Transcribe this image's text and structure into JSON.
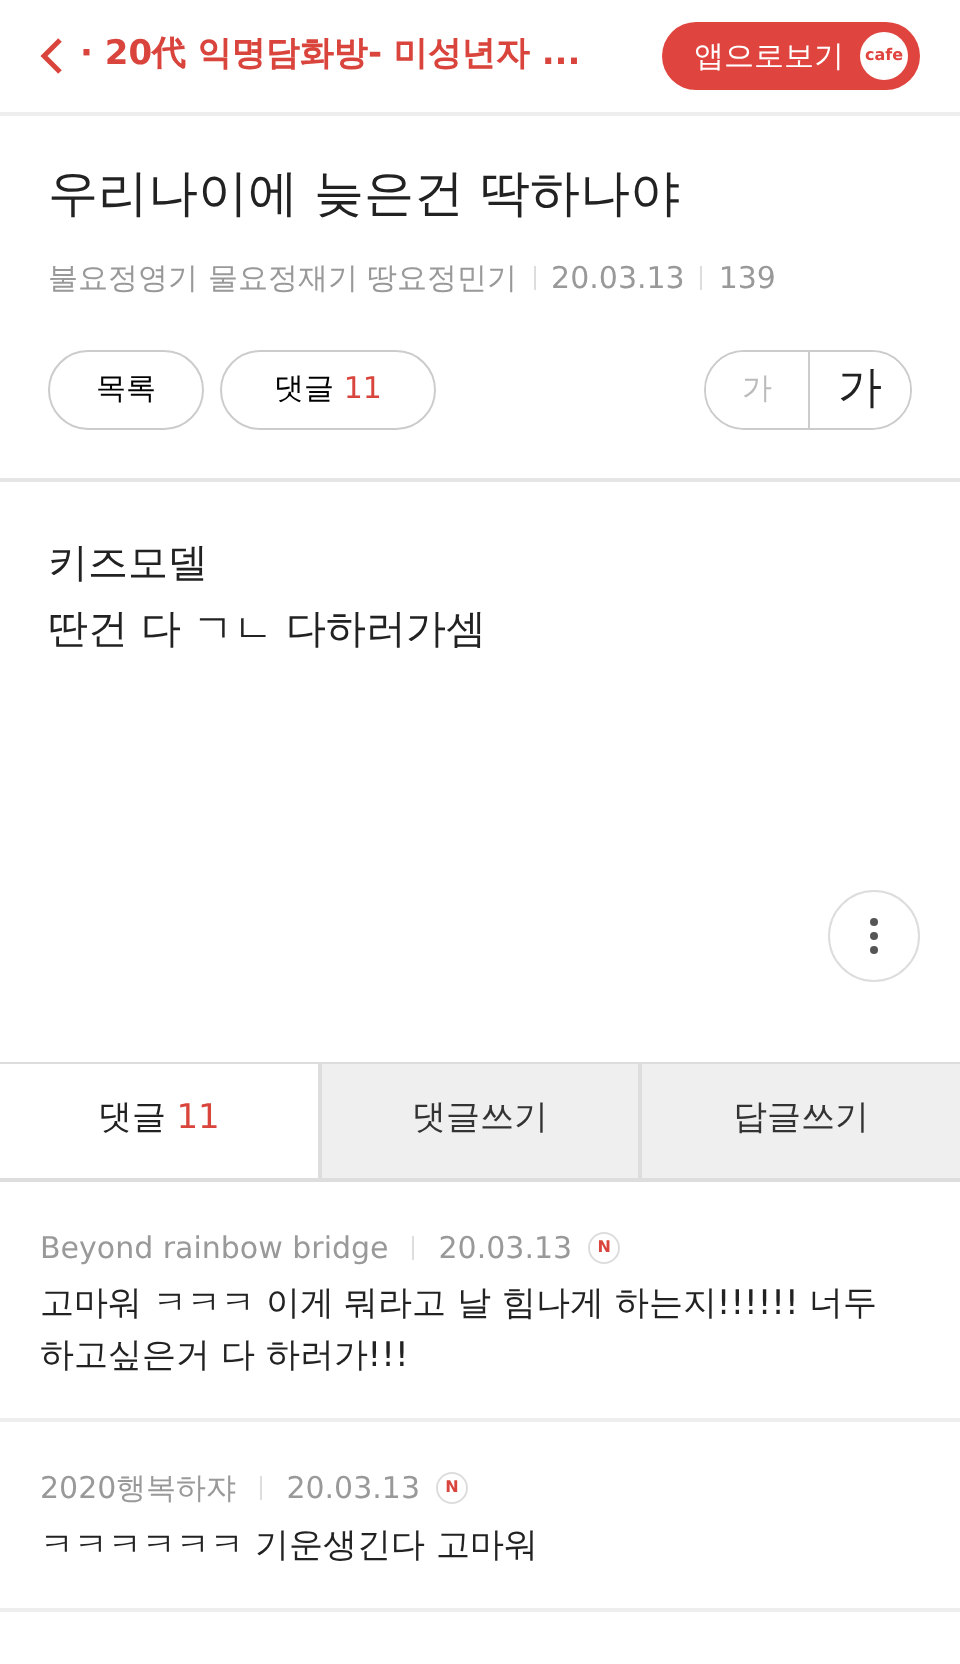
{
  "header": {
    "cafe_title": "· 20代 익명담화방- 미성년자 ...",
    "app_button": "앱으로보기",
    "app_logo": "cafe"
  },
  "post": {
    "title": "우리나이에 늦은건 딱하나야",
    "author": "불요정영기 물요정재기 땅요정민기",
    "date": "20.03.13",
    "views": "139"
  },
  "actions": [
    {
      "label": "목록"
    },
    {
      "label": "댓글",
      "count": "11"
    }
  ],
  "font_sizes": [
    {
      "label": "가",
      "selected": false
    },
    {
      "label": "가",
      "selected": true
    }
  ],
  "body": [
    "키즈모델",
    "딴건 다 ㄱㄴ 다하러가셈"
  ],
  "tabs": [
    {
      "label": "댓글",
      "count": "11",
      "selected": true
    },
    {
      "label": "댓글쓰기",
      "selected": false
    },
    {
      "label": "답글쓰기",
      "selected": false
    }
  ],
  "comments": [
    {
      "author": "Beyond rainbow bridge",
      "date": "20.03.13",
      "new": true,
      "new_mark": "N",
      "text": "고마워 ㅋㅋㅋ 이게 뭐라고 날 힘나게 하는지!!!!!! 너두 하고싶은거 다 하러가!!!"
    },
    {
      "author": "2020행복하쟈",
      "date": "20.03.13",
      "new": true,
      "new_mark": "N",
      "text": "ㅋㅋㅋㅋㅋㅋ 기운생긴다 고마워"
    }
  ]
}
